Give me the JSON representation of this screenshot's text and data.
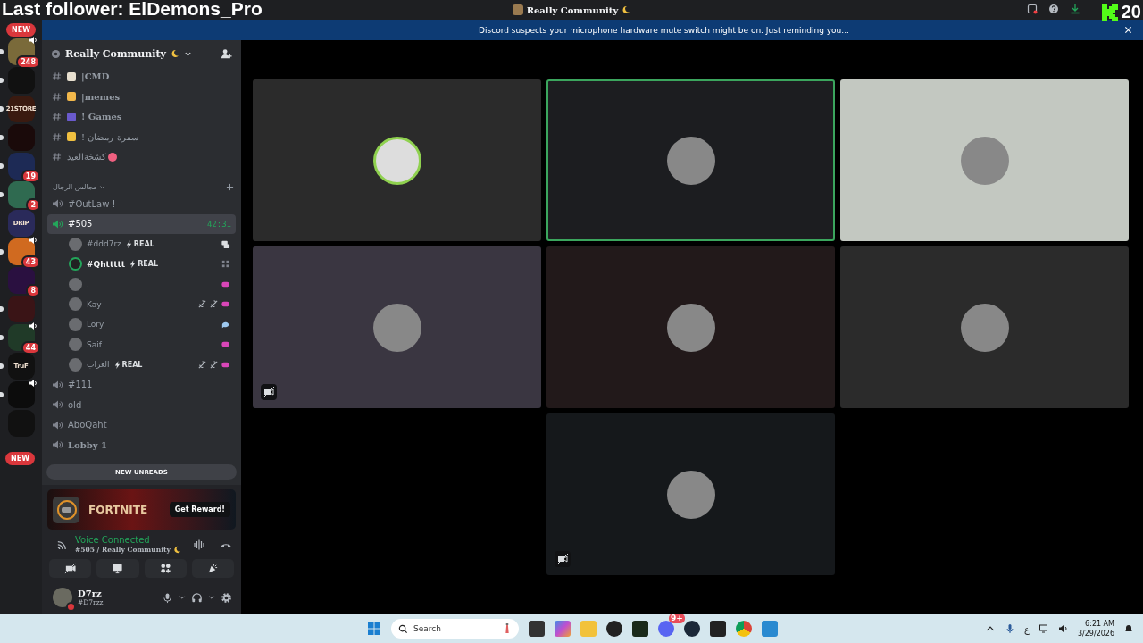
{
  "overlay": {
    "follower": "Last follower: ElDemons_Pro",
    "counter": "20"
  },
  "title_bar": {
    "title": "Really Community"
  },
  "notice": {
    "text": "Discord suspects your microphone hardware mute switch might be on. Just reminding you..."
  },
  "servers": [
    {
      "color": "#7a6a3a",
      "badge": "248",
      "unread": true,
      "speaker": true
    },
    {
      "color": "#111111",
      "unread": true,
      "speaker": false
    },
    {
      "color": "#3a1a10",
      "label": "21STORE",
      "unread": true,
      "speaker": false
    },
    {
      "color": "#1a0a0a",
      "unread": true,
      "speaker": false
    },
    {
      "color": "#1d2a55",
      "badge": "19",
      "unread": true,
      "speaker": false
    },
    {
      "color": "#2f6a50",
      "badge": "2",
      "unread": true,
      "speaker": false
    },
    {
      "color": "#2a2a5a",
      "label": "DRIP",
      "unread": false,
      "speaker": false
    },
    {
      "color": "#d06a20",
      "badge": "43",
      "unread": true,
      "speaker": true
    },
    {
      "color": "#2a1040",
      "badge": "8",
      "unread": false,
      "speaker": false
    },
    {
      "color": "#3a1416",
      "unread": true,
      "speaker": false
    },
    {
      "color": "#203a28",
      "badge": "44",
      "unread": true,
      "speaker": true
    },
    {
      "color": "#111111",
      "label": "TruF",
      "unread": true,
      "speaker": false
    },
    {
      "color": "#0c0c0c",
      "unread": true,
      "speaker": true
    },
    {
      "color": "#111111",
      "unread": false,
      "speaker": false
    }
  ],
  "server_new": [
    "NEW",
    "NEW"
  ],
  "server_name": "Really Community",
  "channels": [
    {
      "kind": "text",
      "color": "#e8e0d0",
      "emoji_after": false,
      "name": "|CMD",
      "bold": true
    },
    {
      "kind": "text",
      "color": "#f2b84b",
      "emoji_after": false,
      "name": "|memes",
      "bold": true
    },
    {
      "kind": "text",
      "color": "#6a5acd",
      "emoji_after": false,
      "name": "! Games",
      "bold": true
    },
    {
      "kind": "text",
      "color": "#f0c040",
      "emoji_after": false,
      "name": "! سفرة-رمضان",
      "bold": false
    },
    {
      "kind": "text",
      "color": "#f06080",
      "emoji_after": true,
      "name": "كشخةالعيد",
      "bold": false
    },
    {
      "kind": "category",
      "name": "مجالس الرجال"
    },
    {
      "kind": "voice",
      "name": "#OutLaw !",
      "selected": false,
      "bold": false
    },
    {
      "kind": "voice",
      "name": "#505",
      "selected": true,
      "bold": false,
      "time": "42:31",
      "members": [
        {
          "name": "#ddd7rz",
          "tag": "REAL",
          "icons": [
            {
              "kind": "stream"
            }
          ],
          "bold": false,
          "speaking": false
        },
        {
          "name": "#Qhttttt",
          "tag": "REAL",
          "icons": [
            {
              "kind": "grid"
            }
          ],
          "bold": true,
          "speaking": true
        },
        {
          "name": ".",
          "icons": [
            {
              "kind": "activity"
            }
          ],
          "bold": false,
          "speaking": false
        },
        {
          "name": "Kay",
          "icons": [
            {
              "kind": "mute"
            },
            {
              "kind": "camera-off"
            },
            {
              "kind": "activity"
            }
          ],
          "bold": false,
          "speaking": false
        },
        {
          "name": "Lory",
          "icons": [
            {
              "kind": "chat"
            }
          ],
          "bold": false,
          "speaking": false
        },
        {
          "name": "Saif",
          "icons": [
            {
              "kind": "activity"
            }
          ],
          "bold": false,
          "speaking": false
        },
        {
          "name": "الغراب",
          "tag": "REAL",
          "icons": [
            {
              "kind": "mute"
            },
            {
              "kind": "camera-off"
            },
            {
              "kind": "activity"
            }
          ],
          "bold": false,
          "speaking": false
        }
      ]
    },
    {
      "kind": "voice",
      "name": "#111",
      "selected": false,
      "bold": false
    },
    {
      "kind": "voice",
      "name": "old",
      "selected": false,
      "bold": false
    },
    {
      "kind": "voice",
      "name": "AboQaht",
      "selected": false,
      "bold": false
    },
    {
      "kind": "voice",
      "name": "Lobby 1",
      "selected": false,
      "bold": true
    }
  ],
  "new_unreads": "NEW UNREADS",
  "promo": {
    "title": "FORTNITE",
    "button": "Get Reward!"
  },
  "voice": {
    "status": "Voice Connected",
    "location": "#505 / Really Community"
  },
  "user": {
    "name": "D7rz",
    "tag": "#D7rzz"
  },
  "tiles": [
    {
      "kind": "video",
      "color": "#2b2b2b",
      "selected": false,
      "camera_off": false,
      "ring": true
    },
    {
      "kind": "video",
      "color": "#1c1d20",
      "selected": true,
      "camera_off": false,
      "ring": false
    },
    {
      "kind": "video",
      "color": "#c3c8c1",
      "selected": false,
      "camera_off": false,
      "ring": false
    },
    {
      "kind": "video",
      "color": "#3a3641",
      "selected": false,
      "camera_off": true,
      "ring": false
    },
    {
      "kind": "video",
      "color": "#22191a",
      "selected": false,
      "camera_off": false,
      "ring": false
    },
    {
      "kind": "video",
      "color": "#2b2b2b",
      "selected": false,
      "camera_off": false,
      "ring": false
    },
    {
      "kind": "empty"
    },
    {
      "kind": "video",
      "color": "#15181b",
      "selected": false,
      "camera_off": true,
      "ring": false
    }
  ],
  "taskbar": {
    "search": {
      "placeholder": "Search"
    },
    "discord_badge": "9+",
    "lang": "ع",
    "time": "6:21 AM",
    "date": "3/29/2026"
  }
}
